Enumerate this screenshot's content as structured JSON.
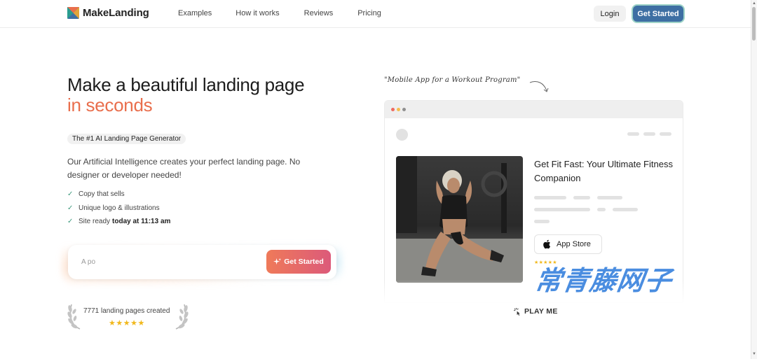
{
  "brand": {
    "name": "MakeLanding"
  },
  "nav": {
    "links": [
      "Examples",
      "How it works",
      "Reviews",
      "Pricing"
    ],
    "login": "Login",
    "get_started": "Get Started"
  },
  "hero": {
    "title_line1": "Make a beautiful landing page",
    "title_line2": "in seconds",
    "tag": "The #1 AI Landing Page Generator",
    "description": "Our Artificial Intelligence creates your perfect landing page. No designer or developer needed!",
    "checks": [
      "Copy that sells",
      "Unique logo & illustrations"
    ],
    "site_ready_prefix": "Site ready",
    "site_ready_time": "today at 11:13 am",
    "input_value": "A po",
    "generate_button": "Get Started",
    "count_text": "7771 landing pages created",
    "rating_stars": "★★★★★"
  },
  "preview": {
    "handnote": "\"Mobile App for a Workout Program\"",
    "app_title": "Get Fit Fast: Your Ultimate Fitness Companion",
    "app_store": "App Store",
    "app_stars": "★★★★★",
    "play_me": "PLAY ME"
  },
  "watermark": "常青藤网子",
  "colors": {
    "accent": "#e96e4c",
    "primary_button": "#3e6fa3",
    "check": "#3f9a7e",
    "star": "#f1b81c"
  }
}
